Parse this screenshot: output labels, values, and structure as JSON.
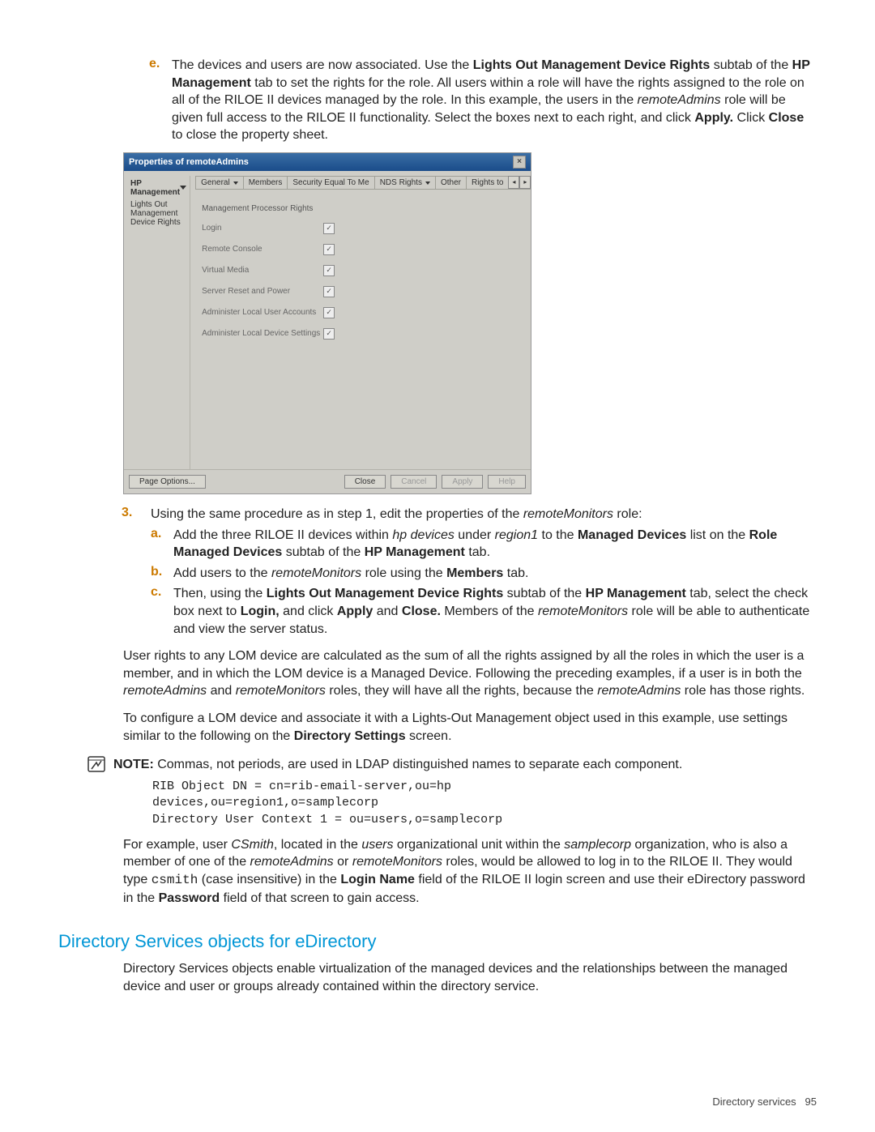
{
  "step_e": {
    "marker": "e.",
    "run1": "The devices and users are now associated. Use the ",
    "b1": "Lights Out Management Device Rights",
    "run2": " subtab of the ",
    "b2": "HP Management",
    "run3": " tab to set the rights for the role. All users within a role will have the rights assigned to the role on all of the RILOE II devices managed by the role. In this example, the users in the ",
    "i1": "remoteAdmins",
    "run4": " role will be given full access to the RILOE II functionality. Select the boxes next to each right, and click ",
    "b3": "Apply.",
    "run5": " Click ",
    "b4": "Close",
    "run6": " to close the property sheet."
  },
  "dialog": {
    "title": "Properties of remoteAdmins",
    "leftTab": "HP Management",
    "leftSub": "Lights Out Management Device Rights",
    "tabs": {
      "general": "General",
      "members": "Members",
      "security": "Security Equal To Me",
      "nds": "NDS Rights",
      "other": "Other",
      "rightsto": "Rights to"
    },
    "section": "Management Processor Rights",
    "rights": {
      "login": "Login",
      "remote": "Remote Console",
      "virtual": "Virtual Media",
      "reset": "Server Reset and Power",
      "users": "Administer Local User Accounts",
      "device": "Administer Local Device Settings"
    },
    "buttons": {
      "pageopt": "Page Options...",
      "close": "Close",
      "cancel": "Cancel",
      "apply": "Apply",
      "help": "Help"
    }
  },
  "step3": {
    "marker": "3.",
    "run1": "Using the same procedure as in step 1, edit the properties of the ",
    "i1": "remoteMonitors",
    "run2": " role:"
  },
  "step3a": {
    "marker": "a.",
    "run1": "Add the three RILOE II devices within ",
    "i1": "hp devices",
    "run2": " under ",
    "i2": "region1",
    "run3": " to the ",
    "b1": "Managed Devices",
    "run4": " list on the ",
    "b2": "Role Managed Devices",
    "run5": " subtab of the ",
    "b3": "HP Management",
    "run6": " tab."
  },
  "step3b": {
    "marker": "b.",
    "run1": "Add users to the ",
    "i1": "remoteMonitors",
    "run2": " role using the ",
    "b1": "Members",
    "run3": " tab."
  },
  "step3c": {
    "marker": "c.",
    "run1": "Then, using the ",
    "b1": "Lights Out Management Device Rights",
    "run2": " subtab of the ",
    "b2": "HP Management",
    "run3": " tab, select the check box next to ",
    "b3": "Login,",
    "run4": " and click ",
    "b4": "Apply",
    "run5": " and ",
    "b5": "Close.",
    "run6": " Members of the ",
    "i1": "remoteMonitors",
    "run7": " role will be able to authenticate and view the server status."
  },
  "para1": {
    "run1": "User rights to any LOM device are calculated as the sum of all the rights assigned by all the roles in which the user is a member, and in which the LOM device is a Managed Device. Following the preceding examples, if a user is in both the ",
    "i1": "remoteAdmins",
    "run2": " and ",
    "i2": "remoteMonitors",
    "run3": " roles, they will have all the rights, because the ",
    "i3": "remoteAdmins",
    "run4": " role has those rights."
  },
  "para2": {
    "run1": "To configure a LOM device and associate it with a Lights-Out Management object used in this example, use settings similar to the following on the ",
    "b1": "Directory Settings",
    "run2": " screen."
  },
  "note": {
    "label": "NOTE:",
    "text": "  Commas, not periods, are used in LDAP distinguished names to separate each component."
  },
  "code": {
    "line1": "RIB Object DN = cn=rib-email-server,ou=hp",
    "line2": "devices,ou=region1,o=samplecorp",
    "line3": "Directory User Context 1 = ou=users,o=samplecorp"
  },
  "para3": {
    "run1": "For example, user ",
    "i1": "CSmith",
    "run2": ", located in the ",
    "i2": "users",
    "run3": " organizational unit within the ",
    "i3": "samplecorp",
    "run4": " organization, who is also a member of one of the ",
    "i4": "remoteAdmins",
    "run5": " or ",
    "i5": "remoteMonitors",
    "run6": " roles, would be allowed to log in to the RILOE II. They would type ",
    "m1": "csmith",
    "run7": " (case insensitive) in the ",
    "b1": "Login Name",
    "run8": " field of the RILOE II login screen and use their eDirectory password in the ",
    "b2": "Password",
    "run9": " field of that screen to gain access."
  },
  "section_heading": "Directory Services objects for eDirectory",
  "para4": "Directory Services objects enable virtualization of the managed devices and the relationships between the managed device and user or groups already contained within the directory service.",
  "footer": {
    "label": "Directory services",
    "page": "95"
  }
}
